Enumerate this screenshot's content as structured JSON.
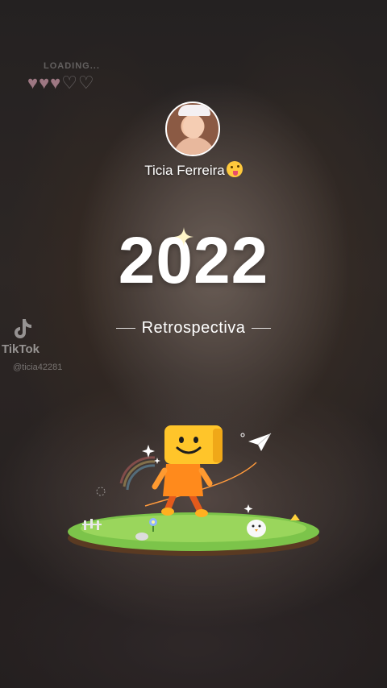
{
  "status": {
    "loading_text": "LOADING..."
  },
  "hearts": {
    "filled": 3,
    "total": 5
  },
  "profile": {
    "name": "Ticia Ferreira",
    "emoji": "zany-face-emoji"
  },
  "hero": {
    "year": "2022",
    "subtitle": "Retrospectiva"
  },
  "watermark": {
    "brand": "TikTok",
    "handle": "@ticia42281"
  },
  "icons": [
    "heart-icon",
    "sparkle-icon",
    "tiktok-logo-icon",
    "paper-plane-icon",
    "flower-icon",
    "chicken-icon",
    "box-character-icon"
  ]
}
